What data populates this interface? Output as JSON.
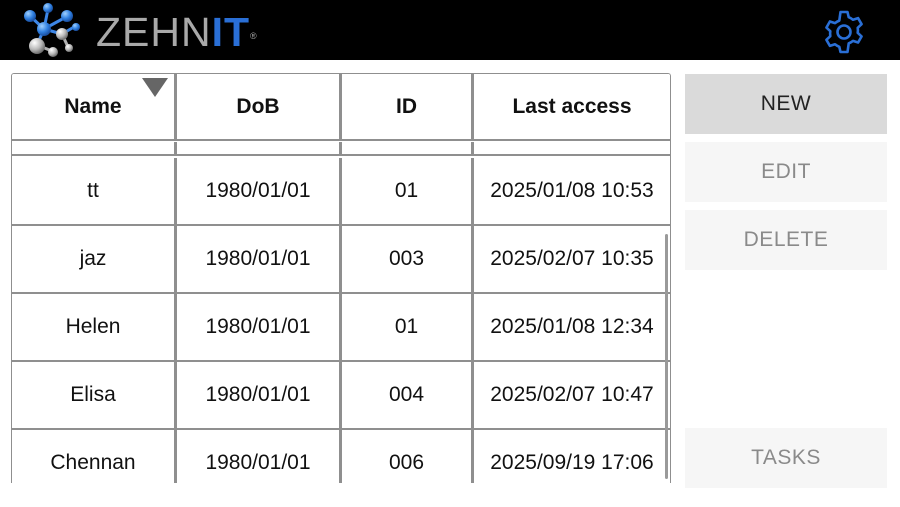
{
  "header": {
    "logo_text_gray": "ZEHN",
    "logo_text_blue": "IT",
    "logo_reg": "®",
    "settings_icon": "gear-icon"
  },
  "colors": {
    "brand_blue": "#2a6fd6",
    "brand_gray": "#a9a9a9",
    "header_bg": "#000000",
    "primary_button_bg": "#dadada",
    "disabled_button_bg": "#f6f6f6",
    "grid_line": "#8f8f8f"
  },
  "table": {
    "columns": [
      "Name",
      "DoB",
      "ID",
      "Last access"
    ],
    "sorted_column": "Name",
    "rows": [
      {
        "name": "tt",
        "dob": "1980/01/01",
        "id": "01",
        "last_access": "2025/01/08 10:53"
      },
      {
        "name": "jaz",
        "dob": "1980/01/01",
        "id": "003",
        "last_access": "2025/02/07 10:35"
      },
      {
        "name": "Helen",
        "dob": "1980/01/01",
        "id": "01",
        "last_access": "2025/01/08 12:34"
      },
      {
        "name": "Elisa",
        "dob": "1980/01/01",
        "id": "004",
        "last_access": "2025/02/07 10:47"
      },
      {
        "name": "Chennan",
        "dob": "1980/01/01",
        "id": "006",
        "last_access": "2025/09/19 17:06"
      }
    ]
  },
  "buttons": {
    "new": "NEW",
    "edit": "EDIT",
    "delete": "DELETE",
    "tasks": "TASKS"
  }
}
